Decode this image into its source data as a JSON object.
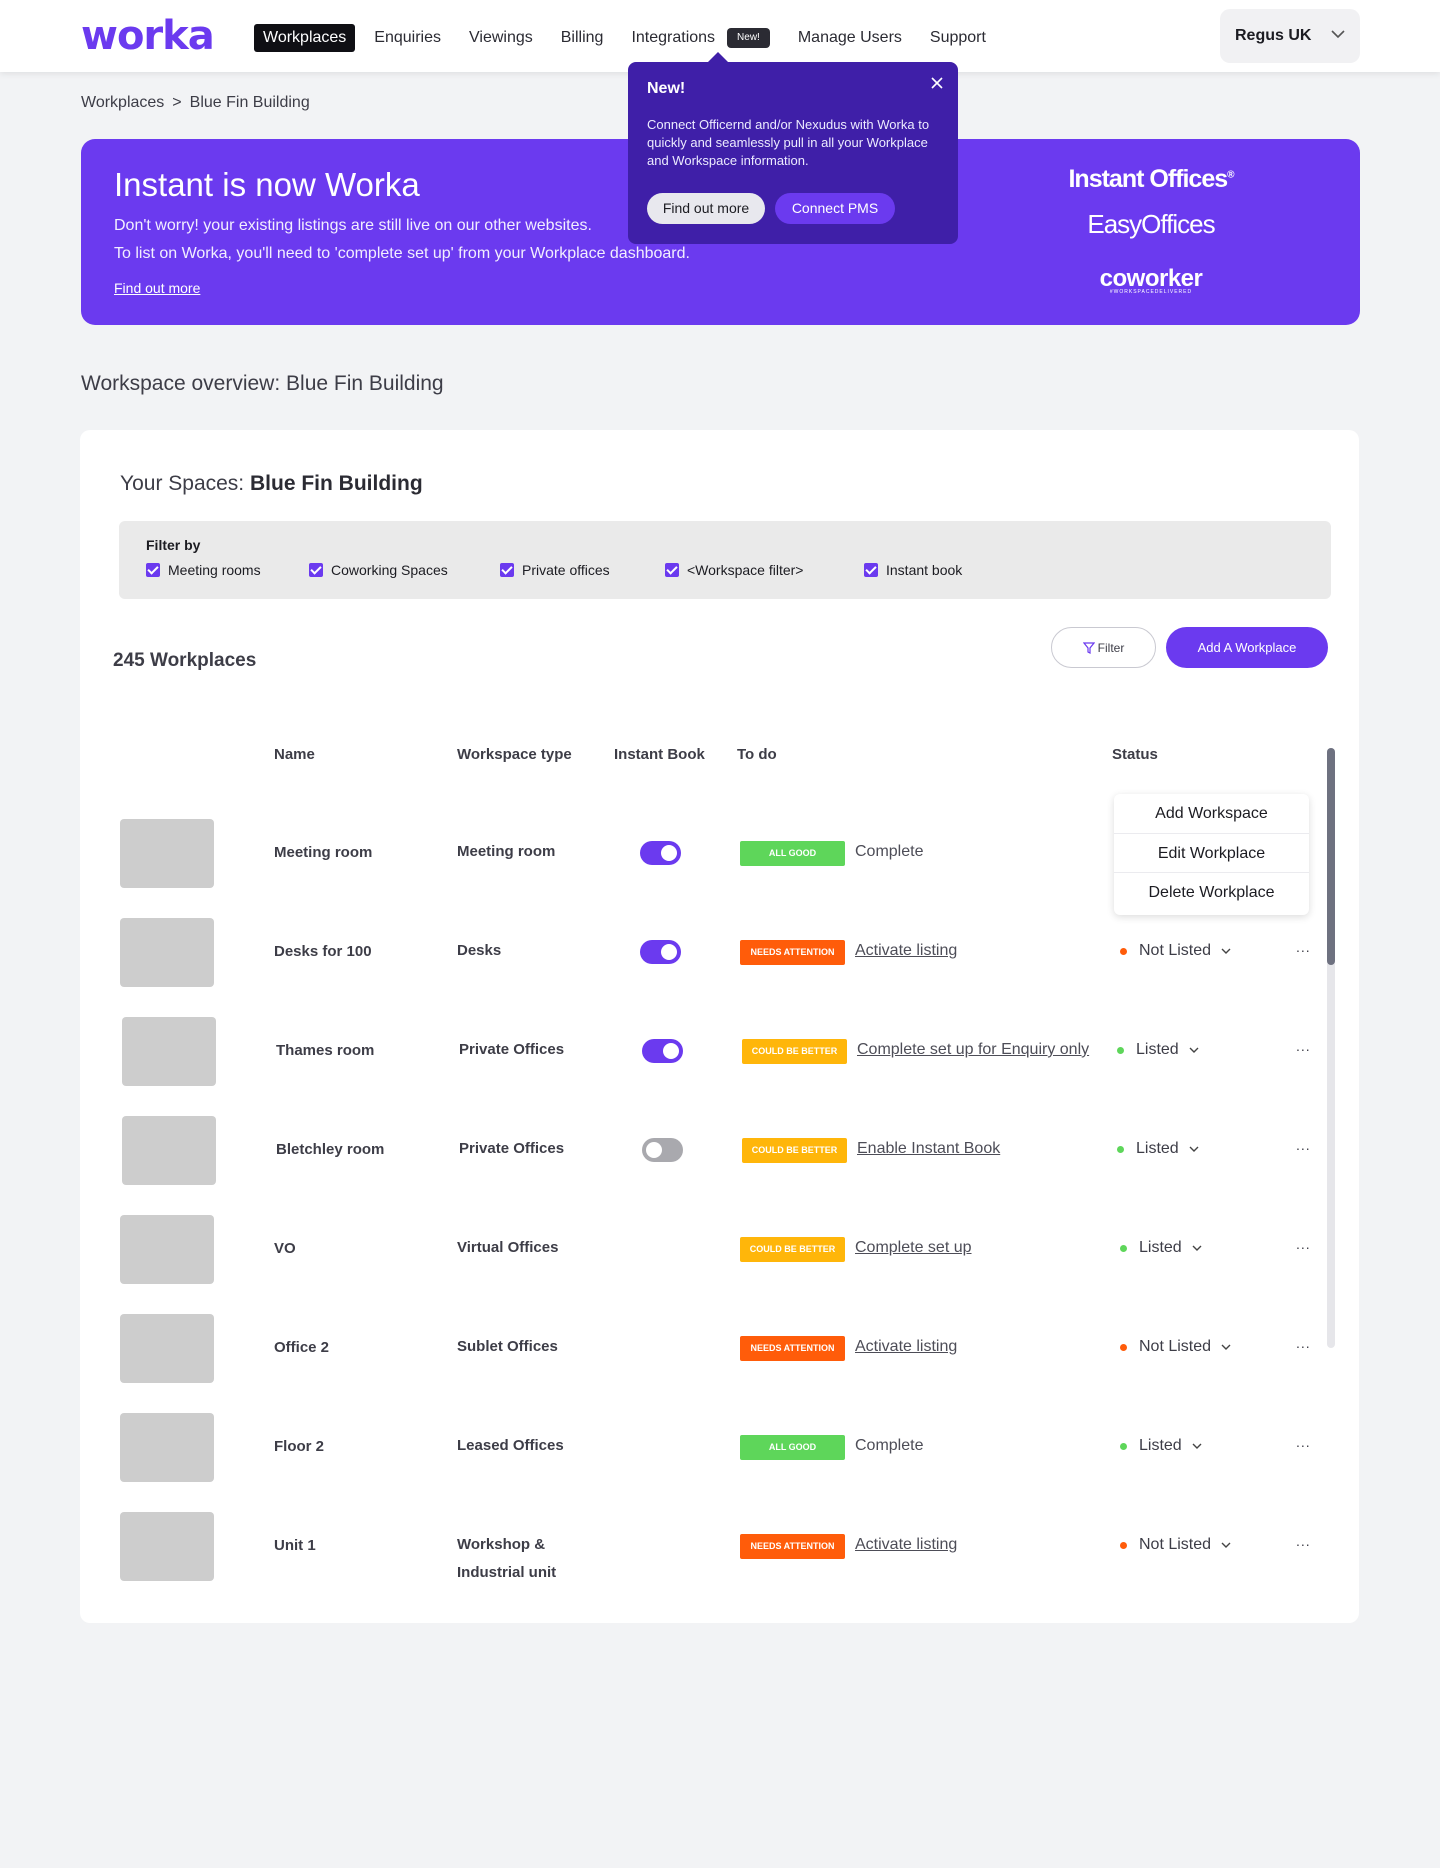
{
  "app": {
    "logo": "worka",
    "nav": [
      "Workplaces",
      "Enquiries",
      "Viewings",
      "Billing",
      "Integrations",
      "Manage Users",
      "Support"
    ],
    "nav_new_badge": "New!",
    "account": "Regus UK"
  },
  "breadcrumb": {
    "root": "Workplaces",
    "sep": ">",
    "current": "Blue Fin Building"
  },
  "banner": {
    "title": "Instant is now Worka",
    "line1": "Don't worry! your existing listings are still live on our other websites.",
    "line2": "To list on Worka, you'll need to 'complete set up' from your Workplace dashboard.",
    "link": "Find out more",
    "brands": {
      "instant": "Instant Offices",
      "instant_mark": "®",
      "easy": "EasyOffices",
      "coworker": "coworker",
      "coworker_tag": "#WORKSPACEDELIVERED"
    }
  },
  "popover": {
    "title": "New!",
    "body": "Connect Officernd and/or Nexudus with Worka to quickly and seamlessly pull in all your Workplace and Workspace information.",
    "btn_primary": "Find out more",
    "btn_secondary": "Connect PMS"
  },
  "overview": {
    "title": "Workspace overview: Blue Fin Building"
  },
  "spaces": {
    "label": "Your Spaces:",
    "building": "Blue Fin Building",
    "filter_by": "Filter by",
    "filters": [
      "Meeting rooms",
      "Coworking Spaces",
      "Private offices",
      "<Workspace filter>",
      "Instant book"
    ],
    "count": "245 Workplaces",
    "filter_btn": "Filter",
    "add_btn": "Add A Workplace"
  },
  "table": {
    "headers": {
      "name": "Name",
      "type": "Workspace type",
      "instant": "Instant Book",
      "todo": "To do",
      "status": "Status"
    },
    "rows": [
      {
        "name": "Meeting room",
        "type": "Meeting room",
        "type2": "",
        "instant": "on",
        "badge": "ALL GOOD",
        "badge_color": "#5ed65a",
        "todo": "Complete",
        "todo_link": false,
        "status": "",
        "dot": "",
        "more": ""
      },
      {
        "name": "Desks for 100",
        "type": "Desks",
        "type2": "",
        "instant": "on",
        "badge": "NEEDS ATTENTION",
        "badge_color": "#ff5c0a",
        "todo": "Activate listing",
        "todo_link": true,
        "status": "Not Listed",
        "dot": "#ff5c0a",
        "more": "..."
      },
      {
        "name": "Thames room",
        "type": "Private Offices",
        "type2": "",
        "instant": "on",
        "badge": "COULD BE BETTER",
        "badge_color": "#ffb60a",
        "todo": "Complete set up for Enquiry only",
        "todo_link": true,
        "status": "Listed",
        "dot": "#5ed65a",
        "more": "..."
      },
      {
        "name": "Bletchley room",
        "type": "Private Offices",
        "type2": "",
        "instant": "off",
        "badge": "COULD BE BETTER",
        "badge_color": "#ffb60a",
        "todo": "Enable Instant Book",
        "todo_link": true,
        "status": "Listed",
        "dot": "#5ed65a",
        "more": "..."
      },
      {
        "name": "VO",
        "type": "Virtual Offices",
        "type2": "",
        "instant": "",
        "badge": "COULD BE BETTER",
        "badge_color": "#ffb60a",
        "todo": "Complete set up",
        "todo_link": true,
        "status": "Listed",
        "dot": "#5ed65a",
        "more": "..."
      },
      {
        "name": "Office 2",
        "type": "Sublet Offices",
        "type2": "",
        "instant": "",
        "badge": "NEEDS ATTENTION",
        "badge_color": "#ff5c0a",
        "todo": "Activate listing",
        "todo_link": true,
        "status": "Not Listed",
        "dot": "#ff5c0a",
        "more": "..."
      },
      {
        "name": "Floor 2",
        "type": "Leased Offices",
        "type2": "",
        "instant": "",
        "badge": "ALL GOOD",
        "badge_color": "#5ed65a",
        "todo": "Complete",
        "todo_link": false,
        "status": "Listed",
        "dot": "#5ed65a",
        "more": "..."
      },
      {
        "name": "Unit 1",
        "type": "Workshop &",
        "type2": "Industrial unit",
        "instant": "",
        "badge": "NEEDS ATTENTION",
        "badge_color": "#ff5c0a",
        "todo": "Activate listing",
        "todo_link": true,
        "status": "Not Listed",
        "dot": "#ff5c0a",
        "more": "..."
      }
    ]
  },
  "context_menu": [
    "Add Workspace",
    "Edit Workplace",
    "Delete Workplace"
  ],
  "colors": {
    "brand": "#6b3aef",
    "popover": "#3f1fa8",
    "good": "#5ed65a",
    "warn": "#ffb60a",
    "alert": "#ff5c0a"
  }
}
